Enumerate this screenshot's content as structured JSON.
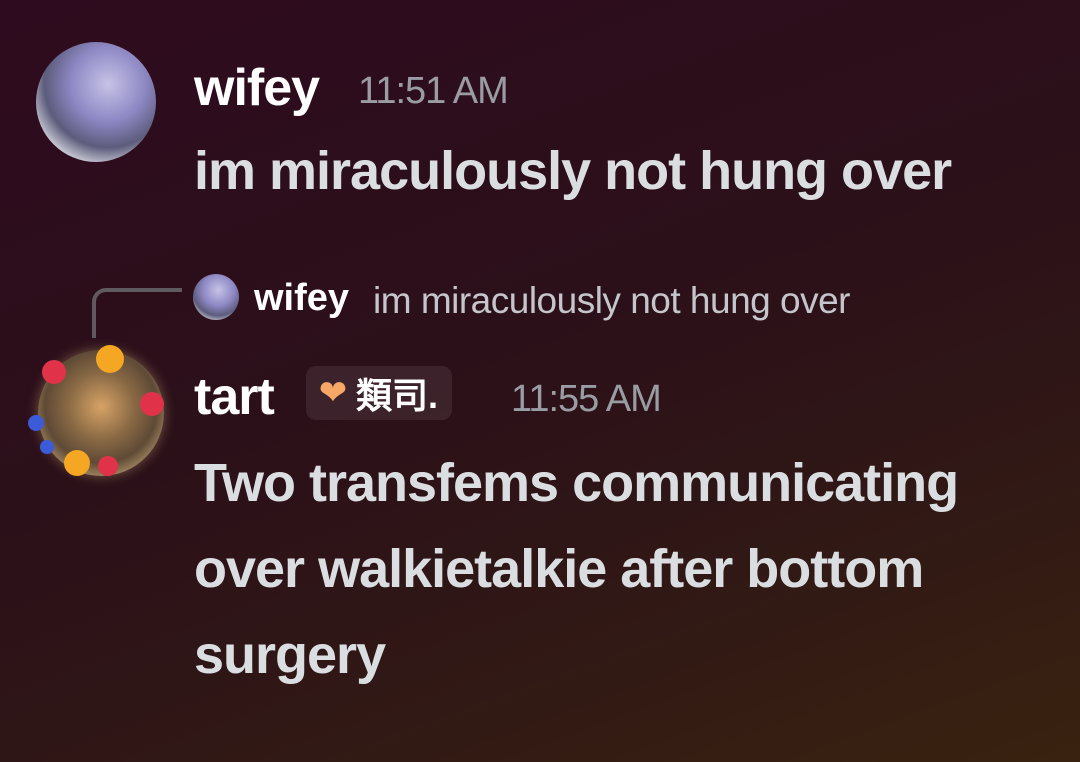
{
  "messages": [
    {
      "username": "wifey",
      "timestamp": "11:51 AM",
      "content": "im miraculously not hung over"
    },
    {
      "reply": {
        "username": "wifey",
        "content": "im miraculously not hung over"
      },
      "username": "tart",
      "tag": {
        "icon": "heart-icon",
        "text": "類司."
      },
      "timestamp": "11:55 AM",
      "content": "Two transfems communicating over walkietalkie after bottom surgery"
    }
  ]
}
